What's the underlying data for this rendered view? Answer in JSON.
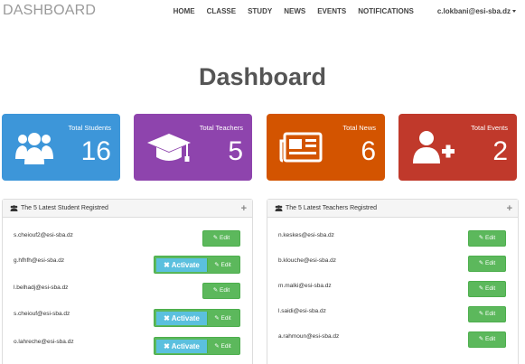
{
  "navbar": {
    "brand": "DASHBOARD",
    "items": [
      "HOME",
      "CLASSE",
      "STUDY",
      "NEWS",
      "EVENTS",
      "NOTIFICATIONS"
    ],
    "user": "c.lokbani@esi-sba.dz"
  },
  "title": "Dashboard",
  "cards": [
    {
      "label": "Total Students",
      "value": "16",
      "icon": "users-icon",
      "color": "#3d96d9"
    },
    {
      "label": "Total Teachers",
      "value": "5",
      "icon": "graduation-cap-icon",
      "color": "#8e44ad"
    },
    {
      "label": "Total News",
      "value": "6",
      "icon": "newspaper-icon",
      "color": "#d35400"
    },
    {
      "label": "Total Events",
      "value": "2",
      "icon": "user-plus-icon",
      "color": "#c0392b"
    }
  ],
  "students_panel": {
    "title": "The 5 Latest Student Registred",
    "rows": [
      {
        "email": "s.cheiouf2@esi-sba.dz",
        "activate": false
      },
      {
        "email": "g.hfhfh@esi-sba.dz",
        "activate": true
      },
      {
        "email": "l.belhadj@esi-sba.dz",
        "activate": false
      },
      {
        "email": "s.cheiouf@esi-sba.dz",
        "activate": true
      },
      {
        "email": "o.lahreche@esi-sba.dz",
        "activate": true
      }
    ]
  },
  "teachers_panel": {
    "title": "The 5 Latest Teachers Registred",
    "rows": [
      {
        "email": "n.keskes@esi-sba.dz"
      },
      {
        "email": "b.klouche@esi-sba.dz"
      },
      {
        "email": "m.malki@esi-sba.dz"
      },
      {
        "email": "l.saidi@esi-sba.dz"
      },
      {
        "email": "a.rahmoun@esi-sba.dz"
      }
    ]
  },
  "buttons": {
    "edit": "Edit",
    "activate": "Activate"
  },
  "colors": {
    "success": "#5cb85c",
    "info": "#5bc0de"
  }
}
